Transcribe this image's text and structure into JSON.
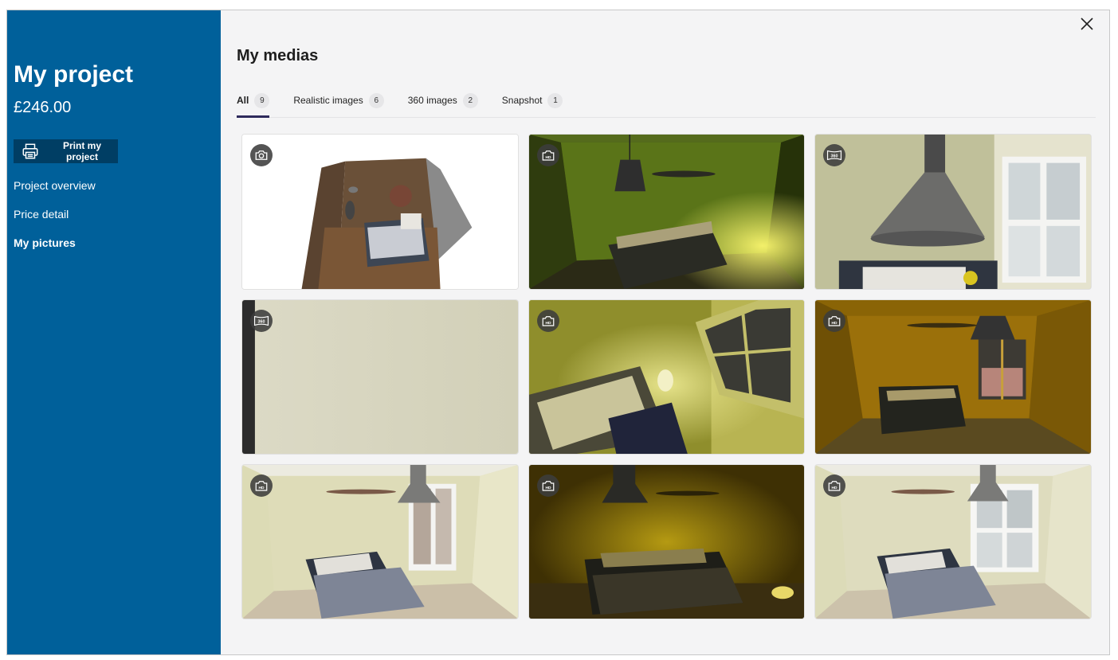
{
  "sidebar": {
    "title": "My project",
    "price": "£246.00",
    "print_button": "Print my project",
    "nav": [
      {
        "label": "Project overview",
        "active": false
      },
      {
        "label": "Price detail",
        "active": false
      },
      {
        "label": "My pictures",
        "active": true
      }
    ]
  },
  "main": {
    "heading": "My medias",
    "tabs": [
      {
        "label": "All",
        "count": "9",
        "active": true
      },
      {
        "label": "Realistic images",
        "count": "6",
        "active": false
      },
      {
        "label": "360 images",
        "count": "2",
        "active": false
      },
      {
        "label": "Snapshot",
        "count": "1",
        "active": false
      }
    ]
  },
  "colors": {
    "sidebar": "#00609a",
    "print_button": "#003e64",
    "active_tab": "#2e2a5c"
  },
  "media": [
    {
      "type": "snapshot",
      "icon": "camera-icon"
    },
    {
      "type": "realistic",
      "icon": "camera-hd-icon"
    },
    {
      "type": "360",
      "icon": "panorama-360-icon"
    },
    {
      "type": "360",
      "icon": "panorama-360-icon"
    },
    {
      "type": "realistic",
      "icon": "camera-hd-icon"
    },
    {
      "type": "realistic",
      "icon": "camera-hd-icon"
    },
    {
      "type": "realistic",
      "icon": "camera-hd-icon"
    },
    {
      "type": "realistic",
      "icon": "camera-hd-icon"
    },
    {
      "type": "realistic",
      "icon": "camera-hd-icon"
    }
  ]
}
